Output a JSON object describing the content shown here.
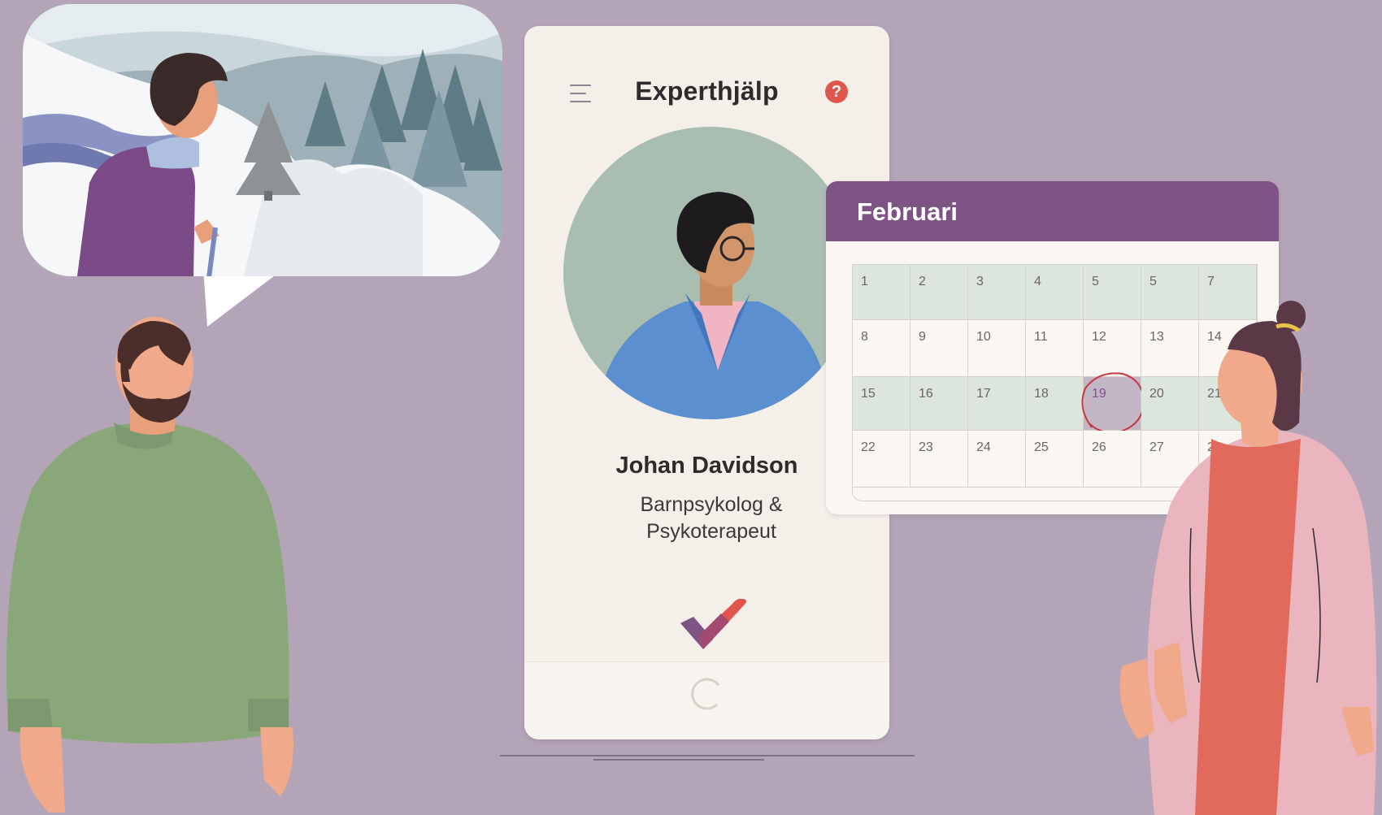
{
  "phone": {
    "title": "Experthjälp",
    "help_icon": "?",
    "expert": {
      "name": "Johan Davidson",
      "role_line1": "Barnpsykolog &",
      "role_line2": "Psykoterapeut"
    }
  },
  "calendar": {
    "month": "Februari",
    "weeks": [
      [
        "1",
        "2",
        "3",
        "4",
        "5",
        "5",
        "7"
      ],
      [
        "8",
        "9",
        "10",
        "11",
        "12",
        "13",
        "14"
      ],
      [
        "15",
        "16",
        "17",
        "18",
        "19",
        "20",
        "21"
      ],
      [
        "22",
        "23",
        "24",
        "25",
        "26",
        "27",
        "28"
      ]
    ],
    "selected_day": "19"
  },
  "colors": {
    "background": "#b4a4b7",
    "calendar_header": "#7e5485",
    "help_icon": "#e0564d",
    "highlight_row": "#dde6dc",
    "selected_cell": "#c3b6c7",
    "selection_ring": "#c63a3f"
  },
  "icons": [
    "hamburger-menu-icon",
    "help-question-icon",
    "checkmark-logo-icon",
    "home-button-icon"
  ]
}
